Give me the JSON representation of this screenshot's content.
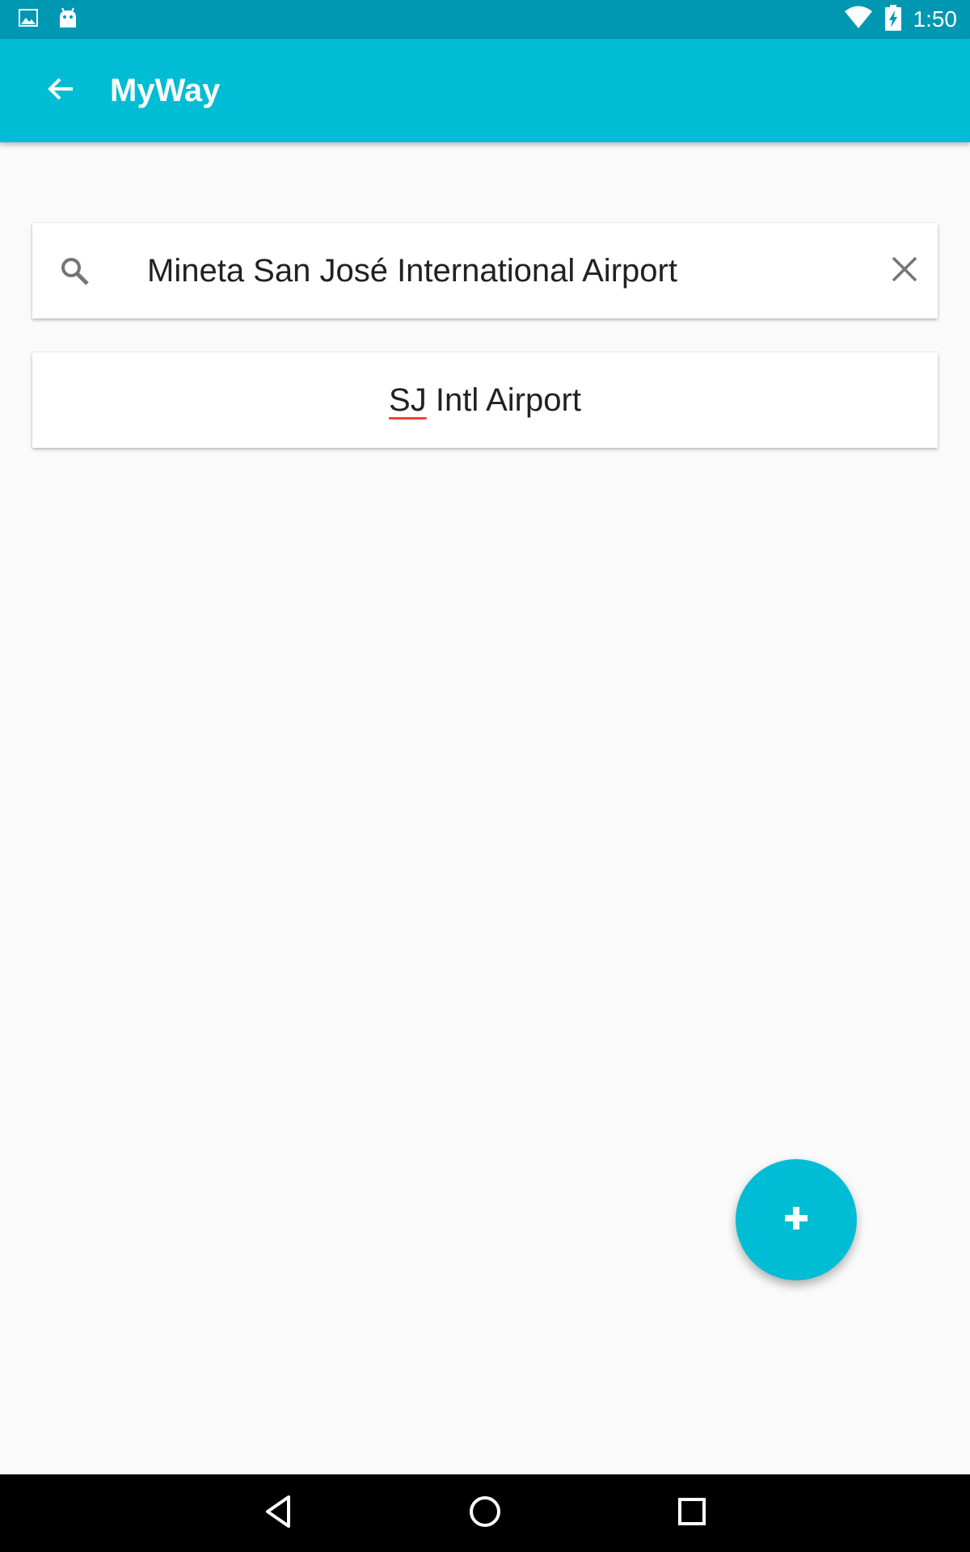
{
  "status_bar": {
    "time": "1:50",
    "icons": [
      "gallery-notification-icon",
      "android-notification-icon",
      "wifi-icon",
      "battery-charging-icon"
    ]
  },
  "app_bar": {
    "title": "MyWay",
    "back_icon": "arrow-back-icon"
  },
  "search": {
    "value": "Mineta San José International Airport",
    "search_icon": "search-icon",
    "clear_icon": "close-icon"
  },
  "results": [
    {
      "word1": "SJ",
      "rest": " Intl Airport"
    }
  ],
  "fab": {
    "icon": "plus-icon"
  },
  "nav_bar": {
    "icons": [
      "back-triangle-icon",
      "home-circle-icon",
      "recents-square-icon"
    ]
  },
  "colors": {
    "status_bar": "#0097b2",
    "app_bar": "#00bcd4",
    "accent": "#00bcd4",
    "background": "#fafafa",
    "spellcheck_underline": "#f44336"
  }
}
